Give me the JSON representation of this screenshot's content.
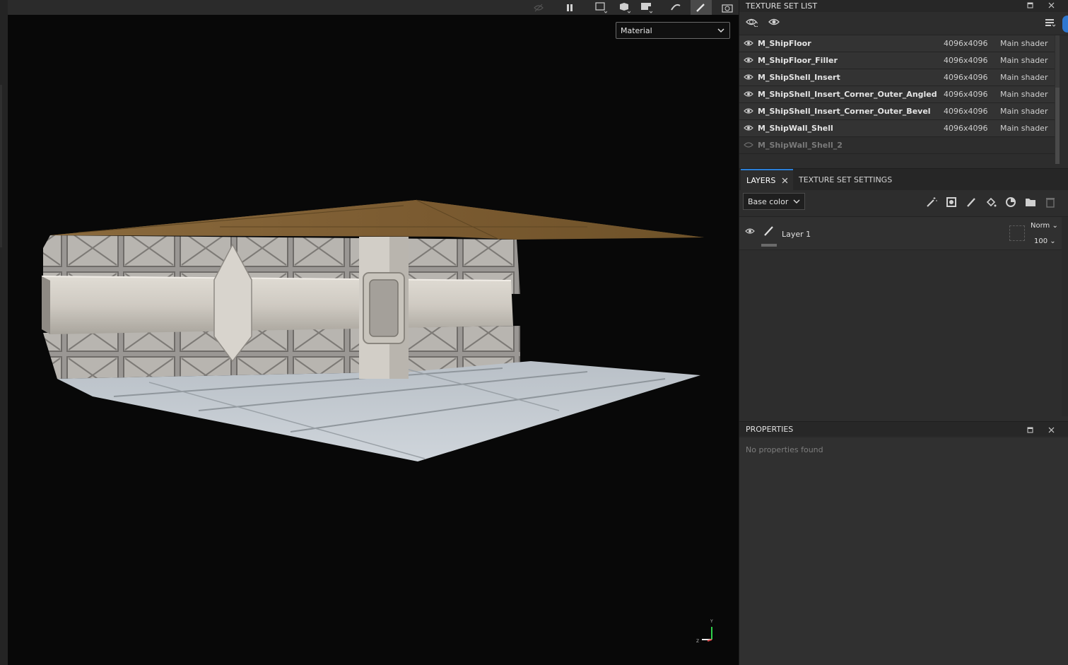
{
  "viewport": {
    "material_select": "Material"
  },
  "texture_set_list": {
    "title": "TEXTURE SET LIST",
    "rows": [
      {
        "name": "M_ShipFloor",
        "resolution": "4096x4096",
        "shader": "Main shader"
      },
      {
        "name": "M_ShipFloor_Filler",
        "resolution": "4096x4096",
        "shader": "Main shader"
      },
      {
        "name": "M_ShipShell_Insert",
        "resolution": "4096x4096",
        "shader": "Main shader"
      },
      {
        "name": "M_ShipShell_Insert_Corner_Outer_Angled",
        "resolution": "4096x4096",
        "shader": "Main shader"
      },
      {
        "name": "M_ShipShell_Insert_Corner_Outer_Bevel",
        "resolution": "4096x4096",
        "shader": "Main shader"
      },
      {
        "name": "M_ShipWall_Shell",
        "resolution": "4096x4096",
        "shader": "Main shader"
      },
      {
        "name": "M_ShipWall_Shell_2",
        "resolution": "",
        "shader": ""
      }
    ]
  },
  "layers_panel": {
    "tab_layers": "LAYERS",
    "tab_texture_set_settings": "TEXTURE SET SETTINGS",
    "channel": "Base color",
    "layer": {
      "name": "Layer 1",
      "blend_mode": "Norm",
      "opacity": "100"
    }
  },
  "properties": {
    "title": "PROPERTIES",
    "empty_text": "No properties found"
  },
  "colors": {
    "accent": "#2b7fd6",
    "panel_bg": "#2d2d2d",
    "viewport_bg": "#080808"
  },
  "axis_gizmo": {
    "y_label": "Y",
    "z_label": "Z"
  }
}
